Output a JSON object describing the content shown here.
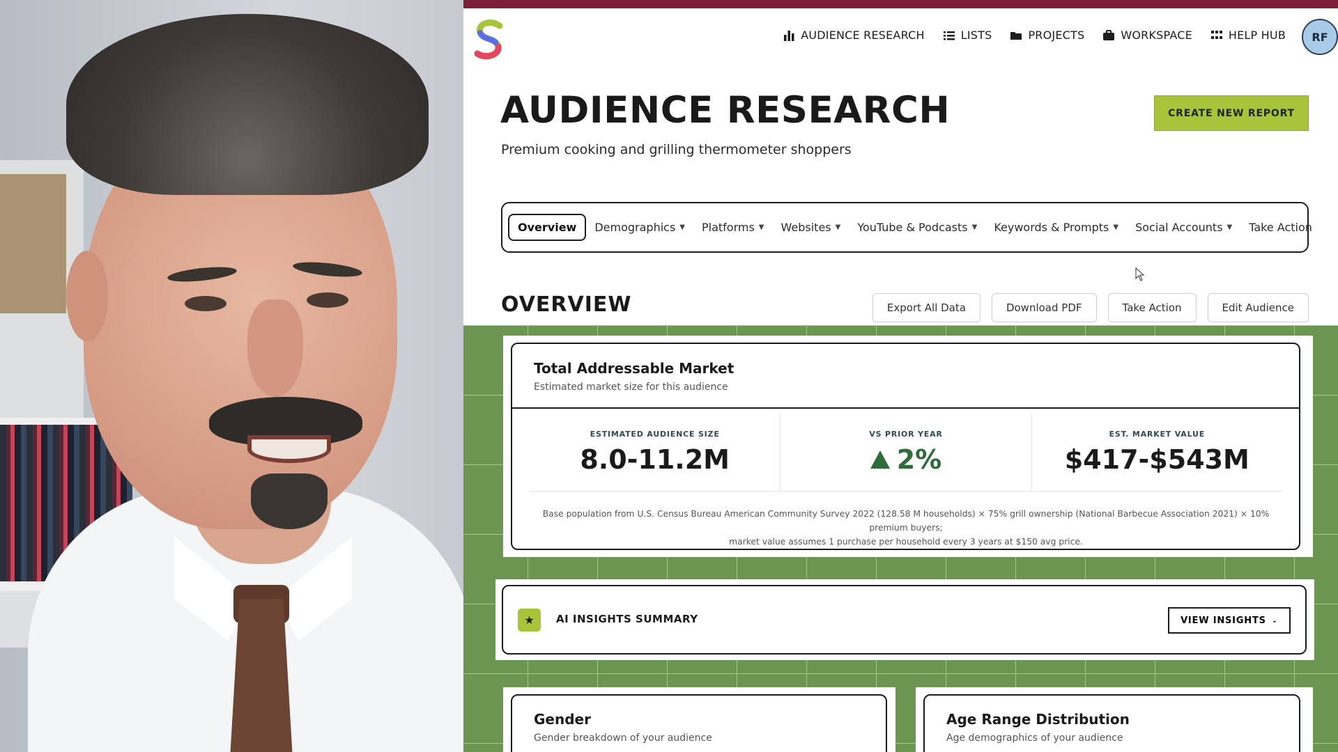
{
  "nav": {
    "items": [
      {
        "label": "AUDIENCE RESEARCH",
        "icon": "bar-chart-icon"
      },
      {
        "label": "LISTS",
        "icon": "list-icon"
      },
      {
        "label": "PROJECTS",
        "icon": "folder-icon"
      },
      {
        "label": "WORKSPACE",
        "icon": "briefcase-icon"
      },
      {
        "label": "HELP HUB",
        "icon": "grid-icon"
      }
    ],
    "avatar_initials": "RF"
  },
  "header": {
    "title": "AUDIENCE RESEARCH",
    "subtitle": "Premium cooking and grilling thermometer shoppers",
    "create_button": "CREATE NEW REPORT"
  },
  "tabs": [
    {
      "label": "Overview",
      "active": true,
      "dropdown": false
    },
    {
      "label": "Demographics",
      "dropdown": true
    },
    {
      "label": "Platforms",
      "dropdown": true
    },
    {
      "label": "Websites",
      "dropdown": true
    },
    {
      "label": "YouTube & Podcasts",
      "dropdown": true
    },
    {
      "label": "Keywords & Prompts",
      "dropdown": true
    },
    {
      "label": "Social Accounts",
      "dropdown": true
    },
    {
      "label": "Take Action",
      "dropdown": false
    }
  ],
  "overview": {
    "title": "OVERVIEW",
    "actions": [
      "Export All Data",
      "Download PDF",
      "Take Action",
      "Edit Audience"
    ]
  },
  "tam": {
    "title": "Total Addressable Market",
    "description": "Estimated market size for this audience",
    "stats": [
      {
        "label": "ESTIMATED AUDIENCE SIZE",
        "value": "8.0-11.2M"
      },
      {
        "label": "VS PRIOR YEAR",
        "value": "2%"
      },
      {
        "label": "EST. MARKET VALUE",
        "value": "$417-$543M"
      }
    ],
    "note_line1": "Base population from U.S. Census Bureau American Community Survey 2022 (128.58 M households) × 75% grill ownership (National Barbecue Association 2021) × 10% premium buyers;",
    "note_line2": "market value assumes 1 purchase per household every 3 years at $150 avg price."
  },
  "ai": {
    "label": "AI INSIGHTS SUMMARY",
    "button": "VIEW INSIGHTS"
  },
  "gender": {
    "title": "Gender",
    "description": "Gender breakdown of your audience"
  },
  "age": {
    "title": "Age Range Distribution",
    "description": "Age demographics of your audience"
  },
  "colors": {
    "brand_top_bar": "#7a1f37",
    "accent_green": "#a7c43a",
    "background_green": "#6b9550",
    "positive": "#2f6b3a"
  }
}
